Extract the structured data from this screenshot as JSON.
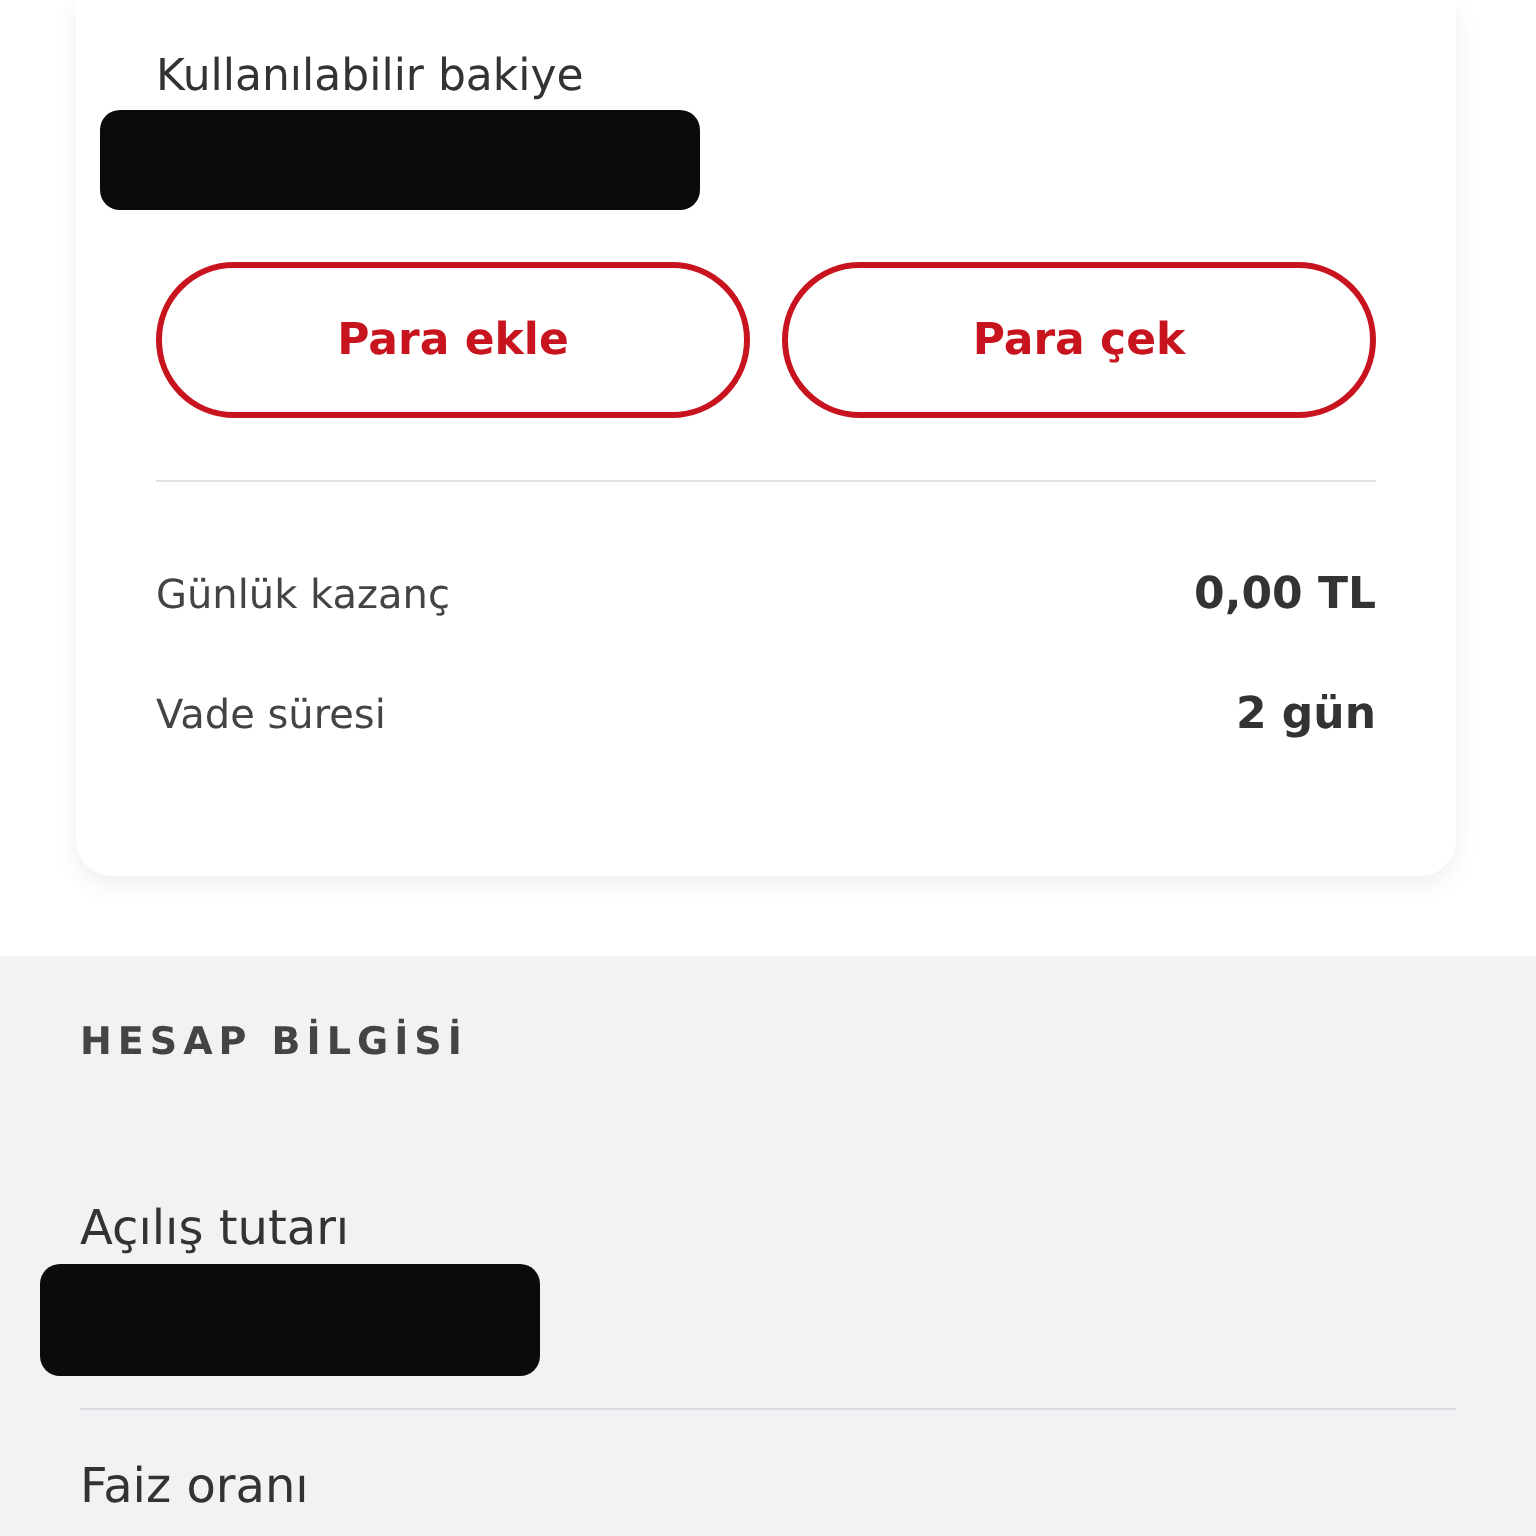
{
  "balance": {
    "label": "Kullanılabilir bakiye",
    "redacted": true
  },
  "actions": [
    {
      "label": "Para ekle"
    },
    {
      "label": "Para çek"
    }
  ],
  "details": [
    {
      "label": "Günlük kazanç",
      "value": "0,00 TL"
    },
    {
      "label": "Vade süresi",
      "value": "2 gün"
    }
  ],
  "account_info": {
    "heading": "HESAP BİLGİSİ",
    "fields": [
      {
        "label": "Açılış tutarı",
        "redacted": true
      },
      {
        "label": "Faiz oranı",
        "redacted": false
      }
    ]
  }
}
